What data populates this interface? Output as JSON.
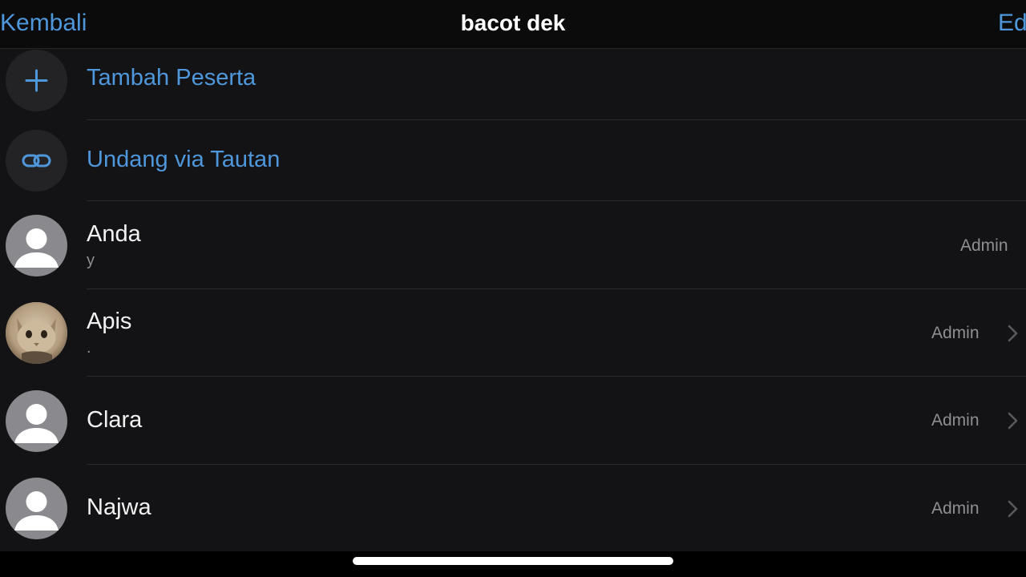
{
  "navbar": {
    "back_label": "Kembali",
    "title": "bacot dek",
    "edit_label": "Ed"
  },
  "actions": [
    {
      "label": "Tambah Peserta",
      "icon": "plus-icon"
    },
    {
      "label": "Undang via Tautan",
      "icon": "link-icon"
    }
  ],
  "members": [
    {
      "name": "Anda",
      "status": "y",
      "role": "Admin",
      "avatar": "default-avatar",
      "has_chevron": false
    },
    {
      "name": "Apis",
      "status": ".",
      "role": "Admin",
      "avatar": "cat-photo",
      "has_chevron": true
    },
    {
      "name": "Clara",
      "status": "",
      "role": "Admin",
      "avatar": "default-avatar",
      "has_chevron": true
    },
    {
      "name": "Najwa",
      "status": "",
      "role": "Admin",
      "avatar": "default-avatar",
      "has_chevron": true
    }
  ],
  "colors": {
    "accent": "#4f97db",
    "background": "#131315",
    "navbar": "#0b0b0c",
    "secondary_text": "#8e8e93"
  }
}
